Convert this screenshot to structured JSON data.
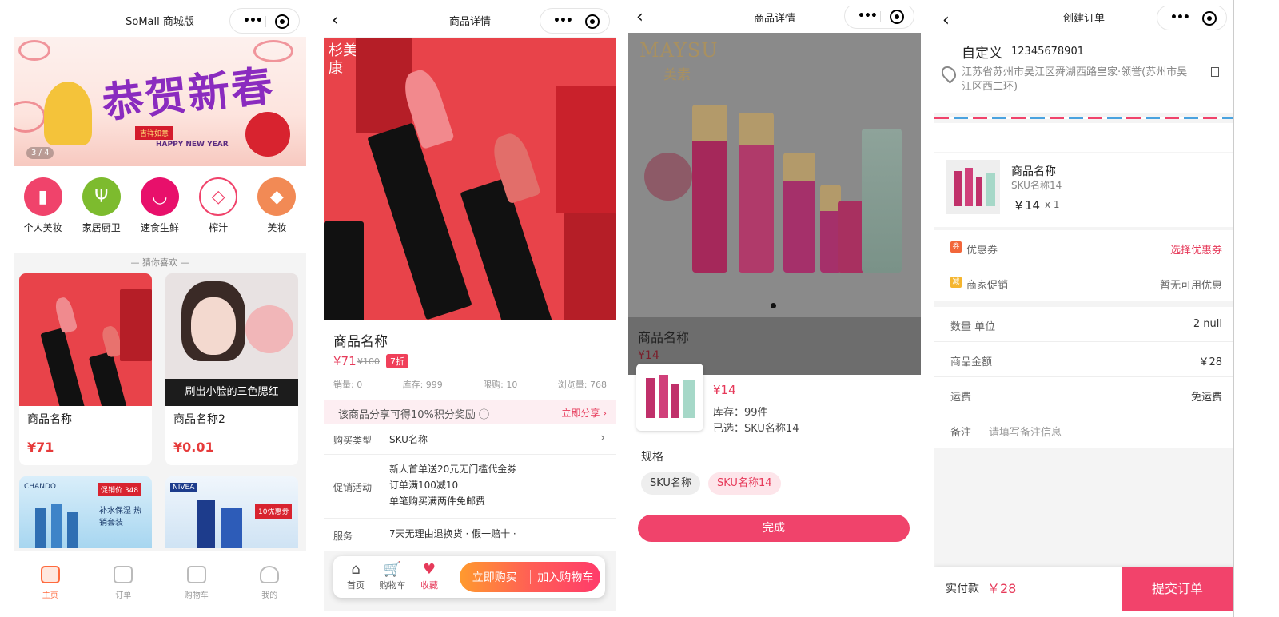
{
  "screen1": {
    "title": "SoMall 商城版",
    "banner": {
      "headline": "恭贺新春",
      "tag": "吉祥如意",
      "english": "HAPPY NEW YEAR",
      "counter": "3 / 4"
    },
    "categories": [
      {
        "label": "个人美妆",
        "icon": "lipstick-icon",
        "color": "#f0436b"
      },
      {
        "label": "家居厨卫",
        "icon": "fork-icon",
        "color": "#7dbb2e"
      },
      {
        "label": "速食生鲜",
        "icon": "bowl-icon",
        "color": "#e8106b"
      },
      {
        "label": "榨汁",
        "icon": "diamond-icon",
        "color": "#f0436b"
      },
      {
        "label": "美妆",
        "icon": "gem-icon",
        "color": "#f28a55"
      }
    ],
    "guess_label": "— 猜你喜欢 —",
    "products": [
      {
        "name": "商品名称",
        "price": "¥71"
      },
      {
        "name": "商品名称2",
        "price": "¥0.01",
        "banner_text": "刷出小脸的三色腮红"
      }
    ],
    "more_products": [
      {
        "brand": "CHANDO",
        "badge": "促销价 348",
        "text": "补水保湿 热销套装"
      },
      {
        "brand": "NIVEA",
        "badge": "10优惠券"
      }
    ],
    "tabs": [
      {
        "label": "主页",
        "active": true
      },
      {
        "label": "订单",
        "active": false
      },
      {
        "label": "购物车",
        "active": false
      },
      {
        "label": "我的",
        "active": false
      }
    ]
  },
  "screen2": {
    "title": "商品详情",
    "image_brand": "杉美 黛康",
    "name": "商品名称",
    "price": "¥71",
    "original_price": "¥100",
    "discount": "7折",
    "stats": {
      "sales": "销量: 0",
      "stock": "库存: 999",
      "limit": "限购: 10",
      "views": "浏览量: 768"
    },
    "share_text": "该商品分享可得10%积分奖励 ⓘ",
    "share_action": "立即分享 ›",
    "buy_type_label": "购买类型",
    "buy_type_value": "SKU名称",
    "promo_label": "促销活动",
    "promo_lines": [
      "新人首单送20元无门槛代金券",
      "订单满100减10",
      "单笔购买满两件免邮费"
    ],
    "service_label": "服务",
    "service_value": "7天无理由退换货 · 假一赔十 ·",
    "bottom": {
      "home": "首页",
      "cart": "购物车",
      "fav": "收藏",
      "buy_now": "立即购买",
      "add_cart": "加入购物车"
    }
  },
  "screen3": {
    "title": "商品详情",
    "brand_en": "MAYSU",
    "brand_cn": "美素",
    "name": "商品名称",
    "price": "¥14",
    "sheet": {
      "price": "¥14",
      "stock": "库存：99件",
      "selected": "已选：SKU名称14",
      "spec_label": "规格",
      "options": [
        "SKU名称",
        "SKU名称14"
      ],
      "done": "完成"
    }
  },
  "screen4": {
    "title": "创建订单",
    "name": "自定义",
    "phone": "12345678901",
    "address": "江苏省苏州市吴江区舜湖西路皇家·领誉(苏州市吴江区西二环)",
    "item": {
      "name": "商品名称",
      "sku": "SKU名称14",
      "price": "￥14",
      "qty": "x 1"
    },
    "coupon_label": "优惠券",
    "coupon_badge": "券",
    "coupon_value": "选择优惠券",
    "promo_label": "商家促销",
    "promo_badge": "减",
    "promo_value": "暂无可用优惠",
    "qty_label": "数量 单位",
    "qty_value": "2 null",
    "amount_label": "商品金额",
    "amount_value": "￥28",
    "freight_label": "运费",
    "freight_value": "免运费",
    "remark_label": "备注",
    "remark_placeholder": "请填写备注信息",
    "pay_label": "实付款",
    "pay_value": "￥28",
    "submit": "提交订单"
  }
}
